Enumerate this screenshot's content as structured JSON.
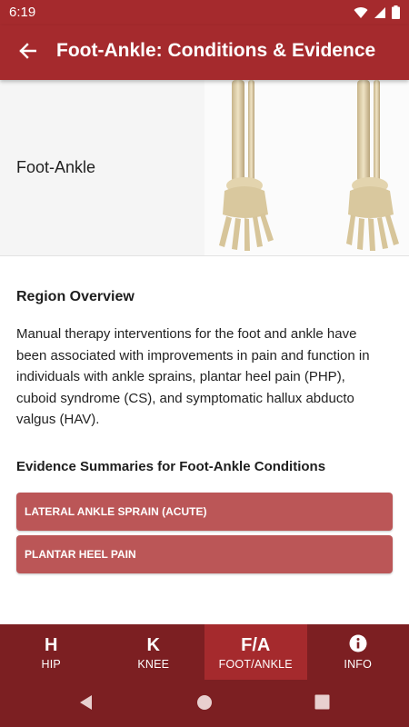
{
  "status_bar": {
    "time": "6:19"
  },
  "app_bar": {
    "title": "Foot-Ankle: Conditions & Evidence"
  },
  "hero": {
    "label": "Foot-Ankle"
  },
  "overview": {
    "title": "Region Overview",
    "text": "Manual therapy interventions for the foot and ankle have been associated with improvements in pain and function in individuals with ankle sprains, plantar heel pain (PHP), cuboid syndrome (CS), and symptomatic hallux abducto valgus (HAV)."
  },
  "evidence": {
    "title": "Evidence Summaries for Foot-Ankle Conditions",
    "items": [
      {
        "label": "LATERAL ANKLE SPRAIN (ACUTE)"
      },
      {
        "label": "PLANTAR HEEL PAIN"
      }
    ]
  },
  "bottom_nav": {
    "items": [
      {
        "icon": "H",
        "label": "HIP"
      },
      {
        "icon": "K",
        "label": "KNEE"
      },
      {
        "icon": "F/A",
        "label": "FOOT/ANKLE"
      },
      {
        "icon": "info-icon",
        "label": "INFO"
      }
    ],
    "active_index": 2
  },
  "colors": {
    "primary": "#a52a2d",
    "nav_dark": "#7c1f22",
    "condition_button": "#bb5657"
  }
}
